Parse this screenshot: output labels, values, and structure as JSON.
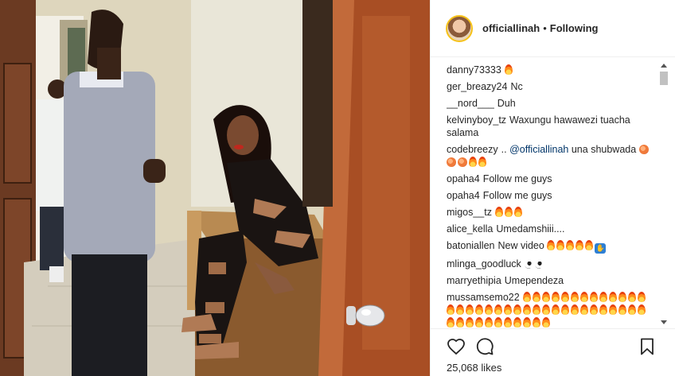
{
  "post": {
    "username": "officiallinah",
    "separator": "•",
    "follow_state": "Following",
    "likes_count": "25,068",
    "likes_label": "likes"
  },
  "comments": [
    {
      "author": "danny73333",
      "text": "",
      "emoji": [
        "fire"
      ]
    },
    {
      "author": "ger_breazy24",
      "text": "Nc",
      "emoji": []
    },
    {
      "author": "__nord___",
      "text": "Duh",
      "emoji": []
    },
    {
      "author": "kelvinyboy_tz",
      "text": "Waxungu hawawezi tuacha salama",
      "emoji": []
    },
    {
      "author": "codebreezy",
      "text": "..",
      "mention": "@officiallinah",
      "after": "una shubwada",
      "emoji": [
        "peach",
        "peach",
        "peach",
        "fire",
        "fire"
      ]
    },
    {
      "author": "opaha4",
      "text": "Follow me guys",
      "emoji": []
    },
    {
      "author": "opaha4",
      "text": "Follow me guys",
      "emoji": []
    },
    {
      "author": "migos__tz",
      "text": "",
      "emoji": [
        "fire",
        "fire",
        "fire"
      ]
    },
    {
      "author": "alice_kella",
      "text": "Umedamshiii....",
      "emoji": []
    },
    {
      "author": "batoniallen",
      "text": "New video",
      "emoji": [
        "fire",
        "fire",
        "fire",
        "fire",
        "fire",
        "pray"
      ]
    },
    {
      "author": "mlinga_goodluck",
      "text": "",
      "emoji": [
        "eyes",
        "eyes"
      ]
    },
    {
      "author": "marryethipia",
      "text": "Umependeza",
      "emoji": []
    },
    {
      "author": "mussamsemo22",
      "text": "",
      "emoji": [
        "fire",
        "fire",
        "fire",
        "fire",
        "fire",
        "fire",
        "fire",
        "fire",
        "fire",
        "fire",
        "fire",
        "fire",
        "fire",
        "fire",
        "fire",
        "fire",
        "fire",
        "fire",
        "fire",
        "fire",
        "fire",
        "fire",
        "fire",
        "fire",
        "fire",
        "fire",
        "fire",
        "fire",
        "fire",
        "fire",
        "fire",
        "fire",
        "fire",
        "fire",
        "fire",
        "fire",
        "fire",
        "fire",
        "fire",
        "fire",
        "fire",
        "fire",
        "fire",
        "fire",
        "fire"
      ]
    }
  ],
  "icons": {
    "like": "heart-icon",
    "comment": "comment-icon",
    "save": "bookmark-icon"
  },
  "colors": {
    "text": "#262626",
    "mention": "#003569",
    "border": "#efefef",
    "avatar_ring": "#f6c21a"
  }
}
